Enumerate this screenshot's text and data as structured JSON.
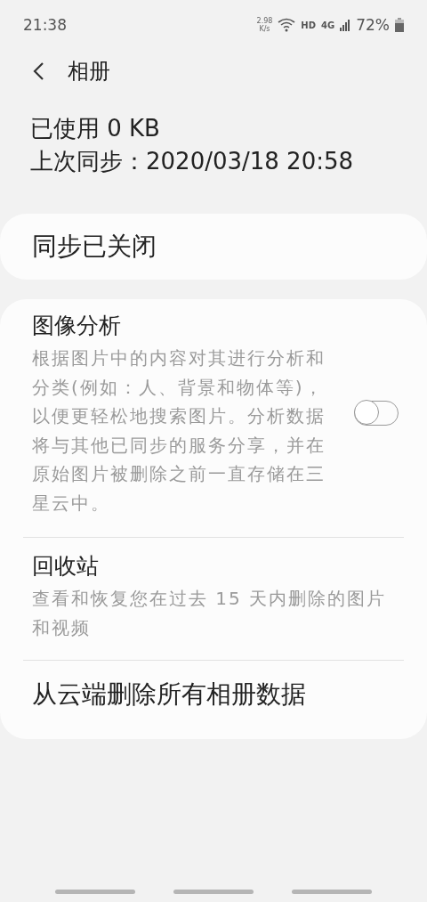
{
  "status_bar": {
    "time": "21:38",
    "speed_value": "2.98",
    "speed_unit": "K/s",
    "hd": "HD",
    "network": "4G",
    "battery": "72%"
  },
  "header": {
    "title": "相册"
  },
  "info": [
    "已使用 0 KB",
    "上次同步：2020/03/18 20:58"
  ],
  "sync_card": {
    "label": "同步已关闭"
  },
  "settings": [
    {
      "kind": "toggle",
      "title": "图像分析",
      "description": "根据图片中的内容对其进行分析和分类(例如：人、背景和物体等)，以便更轻松地搜索图片。分析数据将与其他已同步的服务分享，并在原始图片被删除之前一直存储在三星云中。",
      "on": false
    },
    {
      "kind": "link",
      "title": "回收站",
      "description": "查看和恢复您在过去 15 天内删除的图片和视频"
    },
    {
      "kind": "action",
      "title": "从云端删除所有相册数据"
    }
  ]
}
